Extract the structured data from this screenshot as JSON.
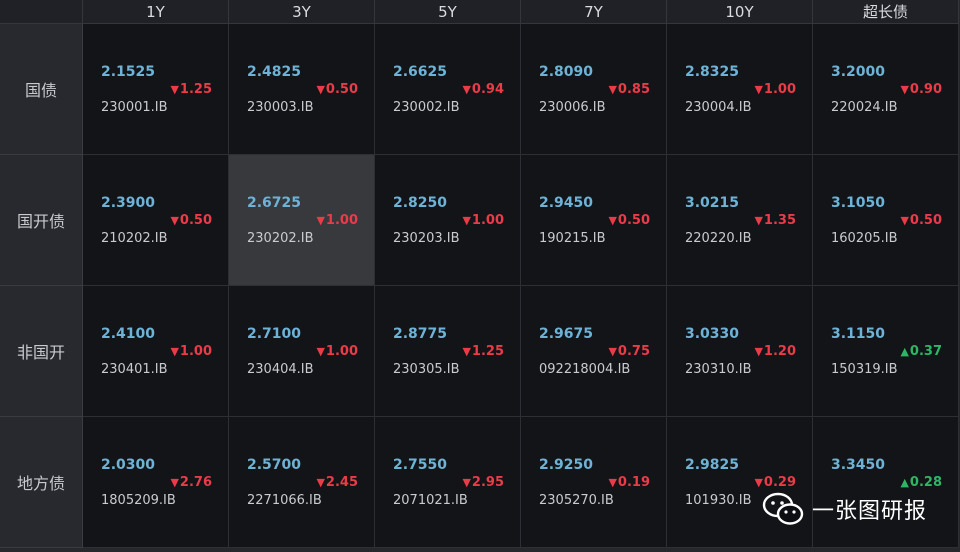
{
  "columns": [
    "1Y",
    "3Y",
    "5Y",
    "7Y",
    "10Y",
    "超长债"
  ],
  "rows": [
    {
      "label": "国债",
      "cells": [
        {
          "yield": "2.1525",
          "change": "1.25",
          "direction": "down",
          "code": "230001.IB"
        },
        {
          "yield": "2.4825",
          "change": "0.50",
          "direction": "down",
          "code": "230003.IB"
        },
        {
          "yield": "2.6625",
          "change": "0.94",
          "direction": "down",
          "code": "230002.IB"
        },
        {
          "yield": "2.8090",
          "change": "0.85",
          "direction": "down",
          "code": "230006.IB"
        },
        {
          "yield": "2.8325",
          "change": "1.00",
          "direction": "down",
          "code": "230004.IB"
        },
        {
          "yield": "3.2000",
          "change": "0.90",
          "direction": "down",
          "code": "220024.IB"
        }
      ]
    },
    {
      "label": "国开债",
      "cells": [
        {
          "yield": "2.3900",
          "change": "0.50",
          "direction": "down",
          "code": "210202.IB"
        },
        {
          "yield": "2.6725",
          "change": "1.00",
          "direction": "down",
          "code": "230202.IB",
          "selected": true
        },
        {
          "yield": "2.8250",
          "change": "1.00",
          "direction": "down",
          "code": "230203.IB"
        },
        {
          "yield": "2.9450",
          "change": "0.50",
          "direction": "down",
          "code": "190215.IB"
        },
        {
          "yield": "3.0215",
          "change": "1.35",
          "direction": "down",
          "code": "220220.IB"
        },
        {
          "yield": "3.1050",
          "change": "0.50",
          "direction": "down",
          "code": "160205.IB"
        }
      ]
    },
    {
      "label": "非国开",
      "cells": [
        {
          "yield": "2.4100",
          "change": "1.00",
          "direction": "down",
          "code": "230401.IB"
        },
        {
          "yield": "2.7100",
          "change": "1.00",
          "direction": "down",
          "code": "230404.IB"
        },
        {
          "yield": "2.8775",
          "change": "1.25",
          "direction": "down",
          "code": "230305.IB"
        },
        {
          "yield": "2.9675",
          "change": "0.75",
          "direction": "down",
          "code": "092218004.IB"
        },
        {
          "yield": "3.0330",
          "change": "1.20",
          "direction": "down",
          "code": "230310.IB"
        },
        {
          "yield": "3.1150",
          "change": "0.37",
          "direction": "up",
          "code": "150319.IB"
        }
      ]
    },
    {
      "label": "地方债",
      "cells": [
        {
          "yield": "2.0300",
          "change": "2.76",
          "direction": "down",
          "code": "1805209.IB"
        },
        {
          "yield": "2.5700",
          "change": "2.45",
          "direction": "down",
          "code": "2271066.IB"
        },
        {
          "yield": "2.7550",
          "change": "2.95",
          "direction": "down",
          "code": "2071021.IB"
        },
        {
          "yield": "2.9250",
          "change": "0.19",
          "direction": "down",
          "code": "2305270.IB"
        },
        {
          "yield": "2.9825",
          "change": "0.29",
          "direction": "down",
          "code": "101930.IB"
        },
        {
          "yield": "3.3450",
          "change": "0.28",
          "direction": "up",
          "code": "——"
        }
      ]
    }
  ],
  "symbols": {
    "down": "▼",
    "up": "▲"
  },
  "colors": {
    "down": "#ea3b48",
    "up": "#2fb665",
    "yield": "#6eb3d6"
  },
  "watermark": {
    "text": "一张图研报",
    "icon": "wechat-icon"
  }
}
